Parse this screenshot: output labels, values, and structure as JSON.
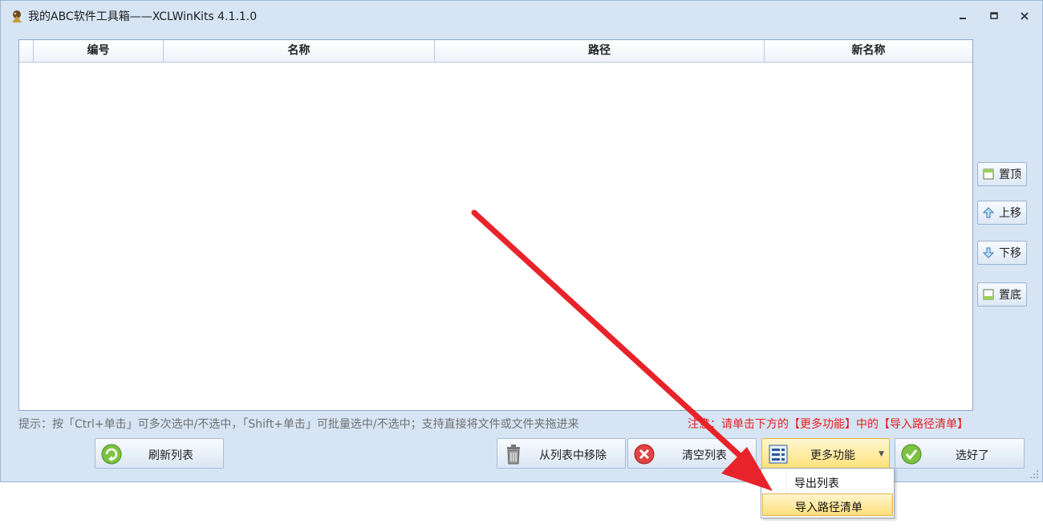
{
  "window": {
    "title": "我的ABC软件工具箱——XCLWinKits  4.1.1.0"
  },
  "grid": {
    "columns": [
      "编号",
      "名称",
      "路径",
      "新名称"
    ],
    "rows": []
  },
  "side_buttons": {
    "top": "置顶",
    "up": "上移",
    "down": "下移",
    "bottom": "置底"
  },
  "hint_text": "提示：按「Ctrl+单击」可多次选中/不选中，「Shift+单击」可批量选中/不选中；支持直接将文件或文件夹拖进来",
  "notice_text": "注意：请单击下方的【更多功能】中的【导入路径清单】",
  "buttons": {
    "refresh": "刷新列表",
    "remove": "从列表中移除",
    "clear": "清空列表",
    "more": "更多功能",
    "ok": "选好了"
  },
  "menu": {
    "items": [
      "导出列表",
      "导入路径清单"
    ],
    "highlighted": "导入路径清单"
  },
  "colors": {
    "window_bg": "#d6e4f4",
    "notice": "#e81c1c",
    "arrow": "#e8232a",
    "highlight": "#ffdf7a"
  }
}
